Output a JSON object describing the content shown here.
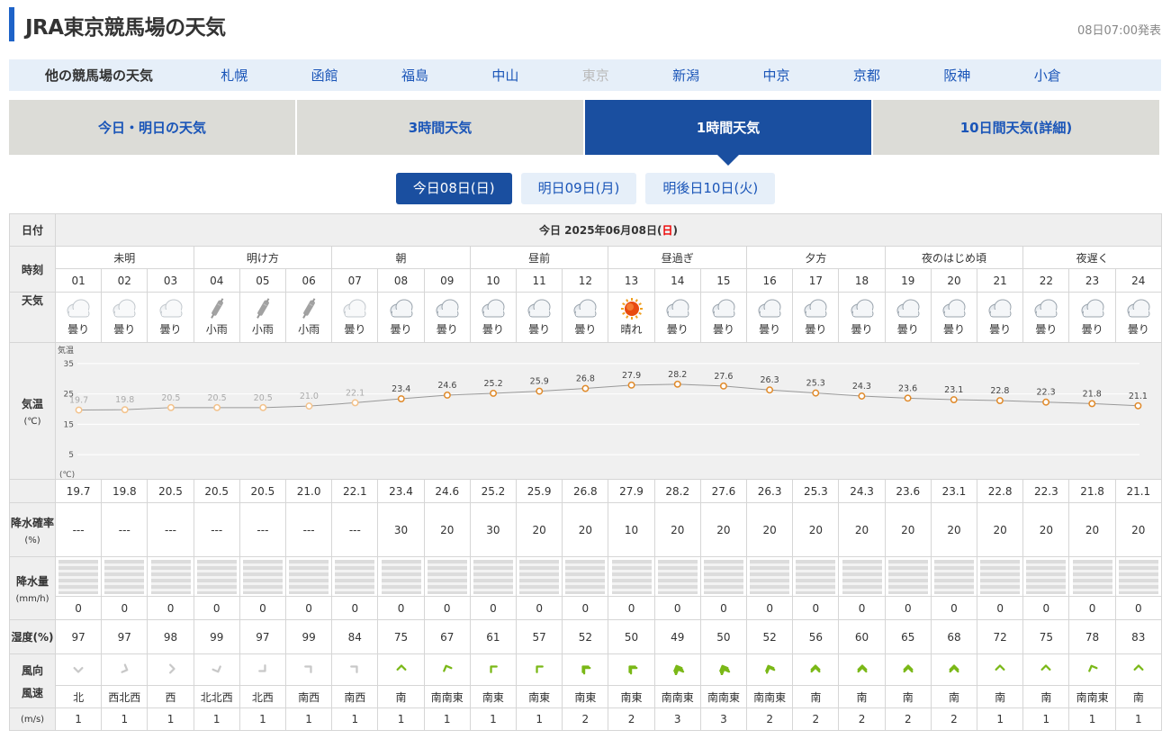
{
  "header": {
    "title": "JRA東京競馬場の天気",
    "issued": "08日07:00発表"
  },
  "other_tracks": {
    "label": "他の競馬場の天気",
    "items": [
      "札幌",
      "函館",
      "福島",
      "中山",
      "東京",
      "新潟",
      "中京",
      "京都",
      "阪神",
      "小倉"
    ],
    "current": "東京"
  },
  "tabs": [
    "今日・明日の天気",
    "3時間天気",
    "1時間天気",
    "10日間天気(詳細)"
  ],
  "active_tab": "1時間天気",
  "days": [
    "今日08日(日)",
    "明日09日(月)",
    "明後日10日(火)"
  ],
  "active_day": "今日08日(日)",
  "table": {
    "labels": {
      "date": "日付",
      "time": "時刻",
      "weather": "天気",
      "temp": "気温",
      "temp_unit": "(℃)",
      "prob": "降水確率",
      "prob_unit": "(%)",
      "rain": "降水量",
      "rain_unit": "(mm/h)",
      "humidity": "湿度(%)",
      "wind_dir": "風向",
      "wind_speed": "風速",
      "wind_unit": "(m/s)"
    },
    "date_prefix": "今日 2025年06月08日(",
    "date_weekday": "日",
    "date_suffix": ")",
    "periods": [
      {
        "label": "未明",
        "span": 3,
        "past": true
      },
      {
        "label": "明け方",
        "span": 3,
        "past": true
      },
      {
        "label": "朝",
        "span": 3,
        "past": false
      },
      {
        "label": "昼前",
        "span": 3,
        "past": false
      },
      {
        "label": "昼過ぎ",
        "span": 3,
        "past": false
      },
      {
        "label": "夕方",
        "span": 3,
        "past": false
      },
      {
        "label": "夜のはじめ頃",
        "span": 3,
        "past": false
      },
      {
        "label": "夜遅く",
        "span": 3,
        "past": false
      }
    ],
    "hours": [
      "01",
      "02",
      "03",
      "04",
      "05",
      "06",
      "07",
      "08",
      "09",
      "10",
      "11",
      "12",
      "13",
      "14",
      "15",
      "16",
      "17",
      "18",
      "19",
      "20",
      "21",
      "22",
      "23",
      "24"
    ],
    "past_count": 7,
    "weather": [
      "曇り",
      "曇り",
      "曇り",
      "小雨",
      "小雨",
      "小雨",
      "曇り",
      "曇り",
      "曇り",
      "曇り",
      "曇り",
      "曇り",
      "晴れ",
      "曇り",
      "曇り",
      "曇り",
      "曇り",
      "曇り",
      "曇り",
      "曇り",
      "曇り",
      "曇り",
      "曇り",
      "曇り"
    ],
    "weather_icons": [
      "cloud-icon",
      "cloud-icon",
      "cloud-icon",
      "umbrella-icon",
      "umbrella-icon",
      "umbrella-icon",
      "cloud-icon",
      "cloud-icon",
      "cloud-icon",
      "cloud-icon",
      "cloud-icon",
      "cloud-icon",
      "sun-icon",
      "cloud-icon",
      "cloud-icon",
      "cloud-icon",
      "cloud-icon",
      "cloud-icon",
      "cloud-icon",
      "cloud-icon",
      "cloud-icon",
      "cloud-icon",
      "cloud-icon",
      "cloud-icon"
    ],
    "temp": [
      "19.7",
      "19.8",
      "20.5",
      "20.5",
      "20.5",
      "21.0",
      "22.1",
      "23.4",
      "24.6",
      "25.2",
      "25.9",
      "26.8",
      "27.9",
      "28.2",
      "27.6",
      "26.3",
      "25.3",
      "24.3",
      "23.6",
      "23.1",
      "22.8",
      "22.3",
      "21.8",
      "21.1"
    ],
    "prob": [
      "---",
      "---",
      "---",
      "---",
      "---",
      "---",
      "---",
      "30",
      "20",
      "30",
      "20",
      "20",
      "10",
      "20",
      "20",
      "20",
      "20",
      "20",
      "20",
      "20",
      "20",
      "20",
      "20",
      "20"
    ],
    "rain": [
      "0",
      "0",
      "0",
      "0",
      "0",
      "0",
      "0",
      "0",
      "0",
      "0",
      "0",
      "0",
      "0",
      "0",
      "0",
      "0",
      "0",
      "0",
      "0",
      "0",
      "0",
      "0",
      "0",
      "0"
    ],
    "humidity": [
      "97",
      "97",
      "98",
      "99",
      "97",
      "99",
      "84",
      "75",
      "67",
      "61",
      "57",
      "52",
      "50",
      "49",
      "50",
      "52",
      "56",
      "60",
      "65",
      "68",
      "72",
      "75",
      "78",
      "83"
    ],
    "wind_dir": [
      "北",
      "西北西",
      "西",
      "北北西",
      "北西",
      "南西",
      "南西",
      "南",
      "南南東",
      "南東",
      "南東",
      "南東",
      "南東",
      "南南東",
      "南南東",
      "南南東",
      "南",
      "南",
      "南",
      "南",
      "南",
      "南",
      "南南東",
      "南"
    ],
    "wind_speed": [
      "1",
      "1",
      "1",
      "1",
      "1",
      "1",
      "1",
      "1",
      "1",
      "1",
      "1",
      "2",
      "2",
      "3",
      "3",
      "2",
      "2",
      "2",
      "2",
      "2",
      "1",
      "1",
      "1",
      "1"
    ]
  },
  "chart_data": {
    "type": "line",
    "title": "",
    "ylabel": "気温",
    "unit": "(℃)",
    "y_ticks": [
      35,
      25,
      15,
      5
    ],
    "x": [
      "01",
      "02",
      "03",
      "04",
      "05",
      "06",
      "07",
      "08",
      "09",
      "10",
      "11",
      "12",
      "13",
      "14",
      "15",
      "16",
      "17",
      "18",
      "19",
      "20",
      "21",
      "22",
      "23",
      "24"
    ],
    "series": [
      {
        "values": [
          19.7,
          19.8,
          20.5,
          20.5,
          20.5,
          21.0,
          22.1,
          23.4,
          24.6,
          25.2,
          25.9,
          26.8,
          27.9,
          28.2,
          27.6,
          26.3,
          25.3,
          24.3,
          23.6,
          23.1,
          22.8,
          22.3,
          21.8,
          21.1
        ]
      }
    ],
    "ylim": [
      0,
      40
    ],
    "grid": true
  },
  "colors": {
    "accent": "#1e63c8",
    "tab_active": "#1a4fa0",
    "link": "#1a55b8",
    "point": "#e08a2a",
    "wind_green": "#7ab817"
  }
}
